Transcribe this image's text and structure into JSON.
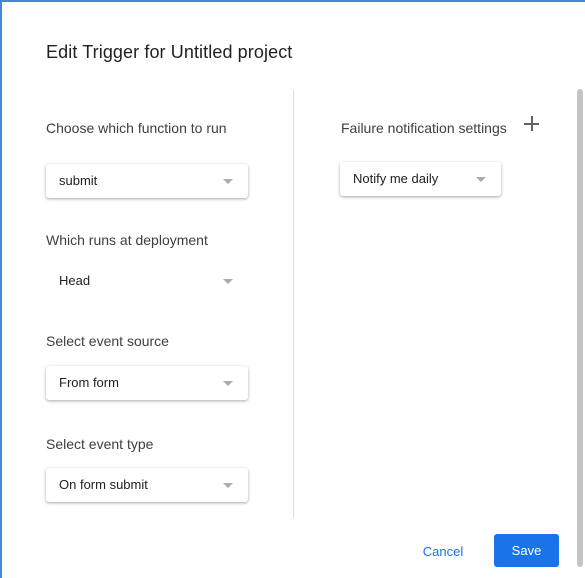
{
  "dialog": {
    "title": "Edit Trigger for Untitled project"
  },
  "function_to_run": {
    "label": "Choose which function to run",
    "selected": "submit"
  },
  "deployment": {
    "label": "Which runs at deployment",
    "selected": "Head"
  },
  "event_source": {
    "label": "Select event source",
    "selected": "From form"
  },
  "event_type": {
    "label": "Select event type",
    "selected": "On form submit"
  },
  "failure_notification": {
    "label": "Failure notification settings",
    "add_icon": "plus-icon",
    "selected": "Notify me daily"
  },
  "actions": {
    "cancel_label": "Cancel",
    "save_label": "Save"
  },
  "colors": {
    "accent": "#1a73e8",
    "window_border": "#4a86d4"
  }
}
